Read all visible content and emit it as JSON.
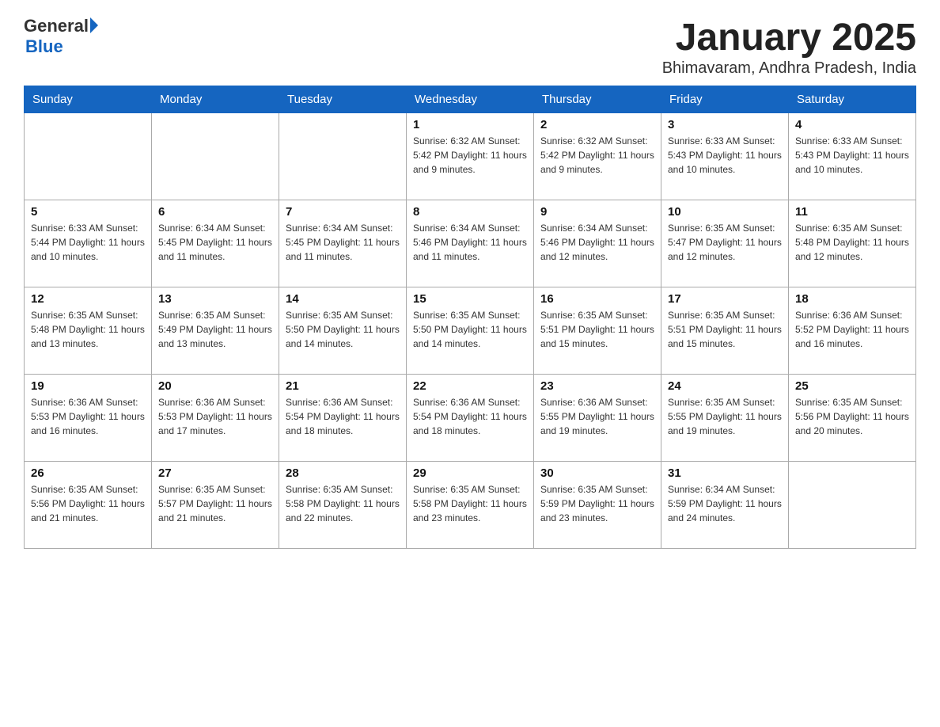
{
  "header": {
    "logo_line1": "General",
    "logo_line2": "Blue",
    "month": "January 2025",
    "location": "Bhimavaram, Andhra Pradesh, India"
  },
  "weekdays": [
    "Sunday",
    "Monday",
    "Tuesday",
    "Wednesday",
    "Thursday",
    "Friday",
    "Saturday"
  ],
  "weeks": [
    [
      {
        "day": "",
        "info": ""
      },
      {
        "day": "",
        "info": ""
      },
      {
        "day": "",
        "info": ""
      },
      {
        "day": "1",
        "info": "Sunrise: 6:32 AM\nSunset: 5:42 PM\nDaylight: 11 hours and 9 minutes."
      },
      {
        "day": "2",
        "info": "Sunrise: 6:32 AM\nSunset: 5:42 PM\nDaylight: 11 hours and 9 minutes."
      },
      {
        "day": "3",
        "info": "Sunrise: 6:33 AM\nSunset: 5:43 PM\nDaylight: 11 hours and 10 minutes."
      },
      {
        "day": "4",
        "info": "Sunrise: 6:33 AM\nSunset: 5:43 PM\nDaylight: 11 hours and 10 minutes."
      }
    ],
    [
      {
        "day": "5",
        "info": "Sunrise: 6:33 AM\nSunset: 5:44 PM\nDaylight: 11 hours and 10 minutes."
      },
      {
        "day": "6",
        "info": "Sunrise: 6:34 AM\nSunset: 5:45 PM\nDaylight: 11 hours and 11 minutes."
      },
      {
        "day": "7",
        "info": "Sunrise: 6:34 AM\nSunset: 5:45 PM\nDaylight: 11 hours and 11 minutes."
      },
      {
        "day": "8",
        "info": "Sunrise: 6:34 AM\nSunset: 5:46 PM\nDaylight: 11 hours and 11 minutes."
      },
      {
        "day": "9",
        "info": "Sunrise: 6:34 AM\nSunset: 5:46 PM\nDaylight: 11 hours and 12 minutes."
      },
      {
        "day": "10",
        "info": "Sunrise: 6:35 AM\nSunset: 5:47 PM\nDaylight: 11 hours and 12 minutes."
      },
      {
        "day": "11",
        "info": "Sunrise: 6:35 AM\nSunset: 5:48 PM\nDaylight: 11 hours and 12 minutes."
      }
    ],
    [
      {
        "day": "12",
        "info": "Sunrise: 6:35 AM\nSunset: 5:48 PM\nDaylight: 11 hours and 13 minutes."
      },
      {
        "day": "13",
        "info": "Sunrise: 6:35 AM\nSunset: 5:49 PM\nDaylight: 11 hours and 13 minutes."
      },
      {
        "day": "14",
        "info": "Sunrise: 6:35 AM\nSunset: 5:50 PM\nDaylight: 11 hours and 14 minutes."
      },
      {
        "day": "15",
        "info": "Sunrise: 6:35 AM\nSunset: 5:50 PM\nDaylight: 11 hours and 14 minutes."
      },
      {
        "day": "16",
        "info": "Sunrise: 6:35 AM\nSunset: 5:51 PM\nDaylight: 11 hours and 15 minutes."
      },
      {
        "day": "17",
        "info": "Sunrise: 6:35 AM\nSunset: 5:51 PM\nDaylight: 11 hours and 15 minutes."
      },
      {
        "day": "18",
        "info": "Sunrise: 6:36 AM\nSunset: 5:52 PM\nDaylight: 11 hours and 16 minutes."
      }
    ],
    [
      {
        "day": "19",
        "info": "Sunrise: 6:36 AM\nSunset: 5:53 PM\nDaylight: 11 hours and 16 minutes."
      },
      {
        "day": "20",
        "info": "Sunrise: 6:36 AM\nSunset: 5:53 PM\nDaylight: 11 hours and 17 minutes."
      },
      {
        "day": "21",
        "info": "Sunrise: 6:36 AM\nSunset: 5:54 PM\nDaylight: 11 hours and 18 minutes."
      },
      {
        "day": "22",
        "info": "Sunrise: 6:36 AM\nSunset: 5:54 PM\nDaylight: 11 hours and 18 minutes."
      },
      {
        "day": "23",
        "info": "Sunrise: 6:36 AM\nSunset: 5:55 PM\nDaylight: 11 hours and 19 minutes."
      },
      {
        "day": "24",
        "info": "Sunrise: 6:35 AM\nSunset: 5:55 PM\nDaylight: 11 hours and 19 minutes."
      },
      {
        "day": "25",
        "info": "Sunrise: 6:35 AM\nSunset: 5:56 PM\nDaylight: 11 hours and 20 minutes."
      }
    ],
    [
      {
        "day": "26",
        "info": "Sunrise: 6:35 AM\nSunset: 5:56 PM\nDaylight: 11 hours and 21 minutes."
      },
      {
        "day": "27",
        "info": "Sunrise: 6:35 AM\nSunset: 5:57 PM\nDaylight: 11 hours and 21 minutes."
      },
      {
        "day": "28",
        "info": "Sunrise: 6:35 AM\nSunset: 5:58 PM\nDaylight: 11 hours and 22 minutes."
      },
      {
        "day": "29",
        "info": "Sunrise: 6:35 AM\nSunset: 5:58 PM\nDaylight: 11 hours and 23 minutes."
      },
      {
        "day": "30",
        "info": "Sunrise: 6:35 AM\nSunset: 5:59 PM\nDaylight: 11 hours and 23 minutes."
      },
      {
        "day": "31",
        "info": "Sunrise: 6:34 AM\nSunset: 5:59 PM\nDaylight: 11 hours and 24 minutes."
      },
      {
        "day": "",
        "info": ""
      }
    ]
  ]
}
